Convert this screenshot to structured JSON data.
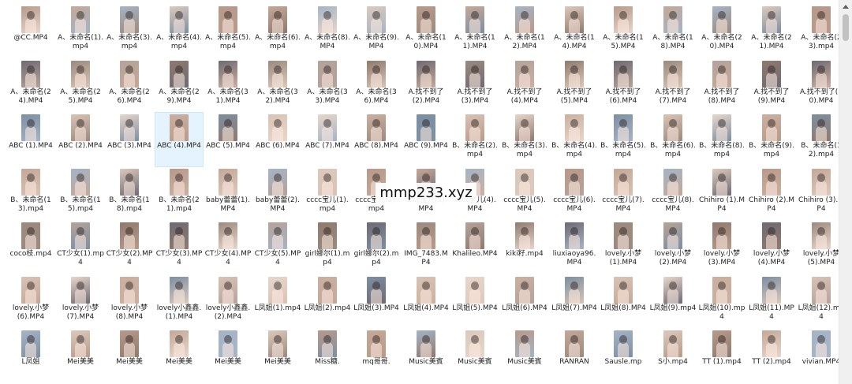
{
  "files": [
    [
      "@CC.MP4",
      "A、未命名(1).mp4",
      "A、未命名(3).mp4",
      "A、未命名(4).mp4",
      "A、未命名(5).mp4",
      "A、未命名(6).mp4",
      "A、未命名(8).MP4",
      "A、未命名(9).MP4",
      "A、未命名(10).MP4",
      "A、未命名(11).MP4",
      "A、未命名(12).MP4",
      "A、未命名(14).MP4",
      "A、未命名(15).MP4",
      "A、未命名(18).MP4",
      "A、未命名(20).MP4",
      "A、未命名(21).MP4",
      "A、未命名(23).mp4"
    ],
    [
      "A、未命名(24).MP4",
      "A、未命名(25).MP4",
      "A、未命名(26).MP4",
      "A、未命名(29).MP4",
      "A、未命名(31).MP4",
      "A、未命名(32).MP4",
      "A、未命名(33).MP4",
      "A、未命名(36).MP4",
      "A.找不到了(2).MP4",
      "A.找不到了(3).MP4",
      "A.找不到了(4).MP4",
      "A.找不到了(5).MP4",
      "A.找不到了(6).MP4",
      "A.找不到了(7).MP4",
      "A.找不到了(8).MP4",
      "A.找不到了(9).MP4",
      "A.找不到了(10).MP4"
    ],
    [
      "ABC (1).MP4",
      "ABC (2).MP4",
      "ABC (3).MP4",
      "ABC (4).MP4",
      "ABC (5).MP4",
      "ABC (6).MP4",
      "ABC (7).MP4",
      "ABC (8).MP4",
      "ABC (9).MP4",
      "B、未命名(2).mp4",
      "B、未命名(3).mp4",
      "B、未命名(4).mp4",
      "B、未命名(5).mp4",
      "B、未命名(6).mp4",
      "B、未命名(8).mp4",
      "B、未命名(9).mp4",
      "B、未命名(12).mp4"
    ],
    [
      "B、未命名(13).mp4",
      "B、未命名(15).mp4",
      "B、未命名(18).mp4",
      "B、未命名(21).mp4",
      "baby蕾蕾(1).MP4",
      "baby蕾蕾(2).MP4",
      "cccc宝儿(1).mp4",
      "cccc宝儿(2).mp4",
      "cccc宝儿(3).MP4",
      "cccc宝儿(4).MP4",
      "cccc宝儿(5).MP4",
      "cccc宝儿(6).MP4",
      "cccc宝儿(7).MP4",
      "cccc宝儿(8).MP4",
      "Chihiro (1).MP4",
      "Chihiro (2).MP4",
      "Chihiro (3).MP4"
    ],
    [
      "coco枝.mp4",
      "CT少女(1).mp4",
      "CT少女(2).MP4",
      "CT少女(3).MP4",
      "CT少女(4).MP4",
      "CT少女(5).MP4",
      "girl娜尔(1).mp4",
      "girl娜尔(2).mp4",
      "IMG_7483.MP4",
      "Khalileo.MP4",
      "kiki籽.mp4",
      "liuxiaoya96.MP4",
      "lovely.小梦(1).MP4",
      "lovely.小梦(2).MP4",
      "lovely.小梦(3).MP4",
      "lovely.小梦(4).MP4",
      "lovely.小梦(5).MP4"
    ],
    [
      "lovely.小梦(6).MP4",
      "lovely.小梦(7).MP4",
      "lovely.小梦(8).MP4",
      "lovely小鑫鑫.(1).MP4",
      "lovely小鑫鑫.(2).MP4",
      "L凤姐(1).mp4",
      "L凤姐(2).mp4",
      "L凤姐(3).MP4",
      "L凤姐(4).MP4",
      "L凤姐(5).MP4",
      "L凤姐(6).MP4",
      "L凤姐(7).MP4",
      "L凤姐(8).MP4",
      "L凤姐(9).mp4",
      "L凤姐(10).mp4",
      "L凤姐(11).MP4",
      "L凤姐(12).mp4"
    ],
    [
      "L凤姐",
      "Mei美美",
      "Mei美美",
      "Mei美美",
      "Mei美美",
      "Mei美美",
      "Miss糖.",
      "mq哥哥.",
      "Music美賓",
      "Music美賓",
      "Music美賓",
      "RANRAN",
      "Sausle.mp",
      "S小.mp4",
      "TT (1).mp4",
      "TT (2).mp4",
      "vivian.MP4"
    ]
  ],
  "watermark": "mmp233.xyz",
  "colors": {
    "selection": "#e5f3ff",
    "thumb_palette": [
      "#b89a8a",
      "#d9c3b5",
      "#8f7a6e",
      "#c4a898",
      "#e8d6cb",
      "#6f6a73",
      "#a5b4c6",
      "#cbb0a0",
      "#9c8a7e",
      "#dcc9bc",
      "#7d8fa3",
      "#b5a39a"
    ]
  }
}
